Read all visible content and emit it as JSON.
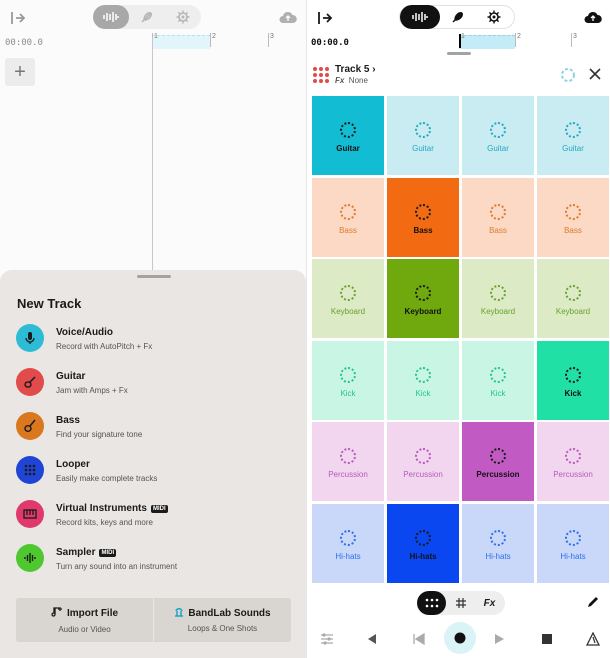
{
  "left": {
    "time": "00:00.0",
    "ruler_marks": [
      "1",
      "2",
      "3"
    ],
    "sheet": {
      "title": "New Track",
      "options": [
        {
          "title": "Voice/Audio",
          "desc": "Record with AutoPitch + Fx",
          "color": "#2dbbd6",
          "icon": "microphone-icon",
          "midi": ""
        },
        {
          "title": "Guitar",
          "desc": "Jam with Amps + Fx",
          "color": "#e24b4b",
          "icon": "guitar-icon",
          "midi": ""
        },
        {
          "title": "Bass",
          "desc": "Find your signature tone",
          "color": "#d9781e",
          "icon": "bass-icon",
          "midi": ""
        },
        {
          "title": "Looper",
          "desc": "Easily make complete tracks",
          "color": "#1f44d6",
          "icon": "looper-icon",
          "midi": ""
        },
        {
          "title": "Virtual Instruments",
          "desc": "Record kits, keys and more",
          "color": "#e0396e",
          "icon": "keyboard-icon",
          "midi": "MIDI"
        },
        {
          "title": "Sampler",
          "desc": "Turn any sound into an instrument",
          "color": "#4fc72e",
          "icon": "waveform-icon",
          "midi": "MIDI"
        }
      ],
      "import": {
        "title": "Import File",
        "sub": "Audio or Video"
      },
      "sounds": {
        "title": "BandLab Sounds",
        "sub": "Loops & One Shots"
      }
    }
  },
  "right": {
    "time": "00:00.0",
    "ruler_marks": [
      "1",
      "2",
      "3"
    ],
    "track": {
      "name": "Track 5",
      "chevron": "›",
      "fx_label": "Fx",
      "fx_value": "None"
    },
    "pad_rows": [
      {
        "label": "Guitar",
        "light": "#c9ecf3",
        "active": "#12bcd3",
        "text": "#23a8c2",
        "active_col": 0
      },
      {
        "label": "Bass",
        "light": "#fbd9c4",
        "active": "#f26a12",
        "text": "#e07a2b",
        "active_col": 1
      },
      {
        "label": "Keyboard",
        "light": "#dcebc6",
        "active": "#6fa90d",
        "text": "#69a12a",
        "active_col": 1
      },
      {
        "label": "Kick",
        "light": "#c9f5e4",
        "active": "#20e0a6",
        "text": "#25c493",
        "active_col": 3
      },
      {
        "label": "Percussion",
        "light": "#f2d6f0",
        "active": "#c25ac4",
        "text": "#b65bb8",
        "active_col": 2
      },
      {
        "label": "Hi-hats",
        "light": "#c9d8f8",
        "active": "#0a47f0",
        "text": "#2d6ff0",
        "active_col": 1
      }
    ],
    "modes": [
      "dots",
      "grid",
      "Fx"
    ]
  }
}
